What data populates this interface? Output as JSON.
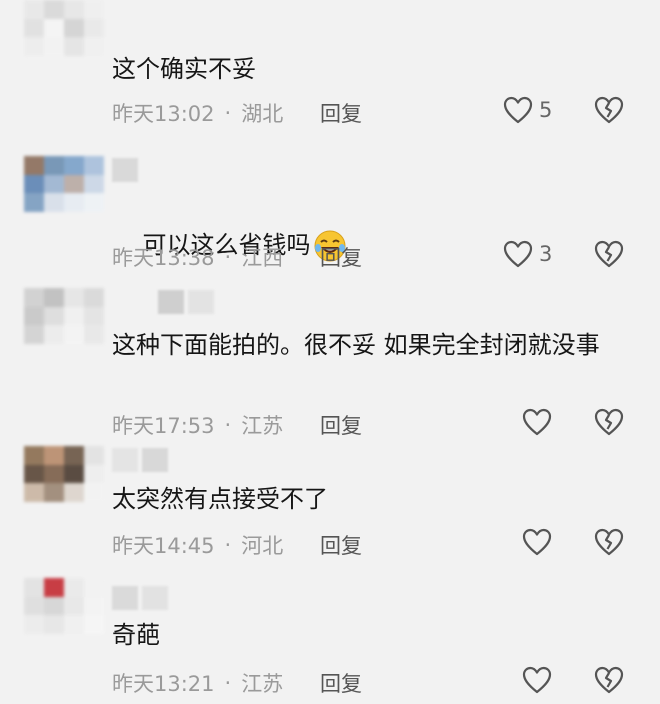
{
  "comments": [
    {
      "text": "这个确实不妥",
      "time": "昨天13:02",
      "location": "湖北",
      "reply": "回复",
      "likes": "5",
      "avatar_colors": [
        "#e8e8e8",
        "#d8d8d8",
        "#e6e6e6",
        "#efefef",
        "#e0e0e0",
        "#f5f5f5",
        "#d2d2d2",
        "#e9e9e9",
        "#ededed",
        "#f3f3f3",
        "#e4e4e4",
        "#f0f0f0"
      ]
    },
    {
      "text": "可以这么省钱吗",
      "time": "昨天13:38",
      "location": "江西",
      "reply": "回复",
      "likes": "3",
      "emoji": "laughing-crying-emoji",
      "avatar_colors": [
        "#8a6d5a",
        "#6c8fb1",
        "#7aa0c8",
        "#a7bfdb",
        "#5d84b3",
        "#9bb3d0",
        "#b8a9a3",
        "#c9d6e6",
        "#7a9cc0",
        "#d7dfea",
        "#e6ecf3",
        "#eef2f6"
      ]
    },
    {
      "text": "这种下面能拍的。很不妥 如果完全封闭就没事",
      "time": "昨天17:53",
      "location": "江苏",
      "reply": "回复",
      "likes": "",
      "avatar_colors": [
        "#cfcfcf",
        "#bdbdbd",
        "#e5e5e5",
        "#d8d8d8",
        "#c6c6c6",
        "#dcdcdc",
        "#f0f0f0",
        "#e3e3e3",
        "#d1d1d1",
        "#ececec",
        "#f4f4f4",
        "#e8e8e8"
      ]
    },
    {
      "text": "太突然有点接受不了",
      "time": "昨天14:45",
      "location": "河北",
      "reply": "回复",
      "likes": "",
      "avatar_colors": [
        "#8a6d4f",
        "#b88a6a",
        "#6a5543",
        "#e2e2e2",
        "#5a4636",
        "#7b5e48",
        "#4a3b30",
        "#eeeeee",
        "#c9b5a2",
        "#9b8673",
        "#dcd4cc",
        "#f3f3f3"
      ]
    },
    {
      "text": "奇葩",
      "time": "昨天13:21",
      "location": "江苏",
      "reply": "回复",
      "likes": "",
      "avatar_colors": [
        "#e2e2e2",
        "#c42a32",
        "#eaeaea",
        "#f2f2f2",
        "#dedede",
        "#d5d5d5",
        "#e8e8e8",
        "#f4f4f4",
        "#ececec",
        "#e6e6e6",
        "#f0f0f0",
        "#f6f6f6"
      ]
    }
  ]
}
